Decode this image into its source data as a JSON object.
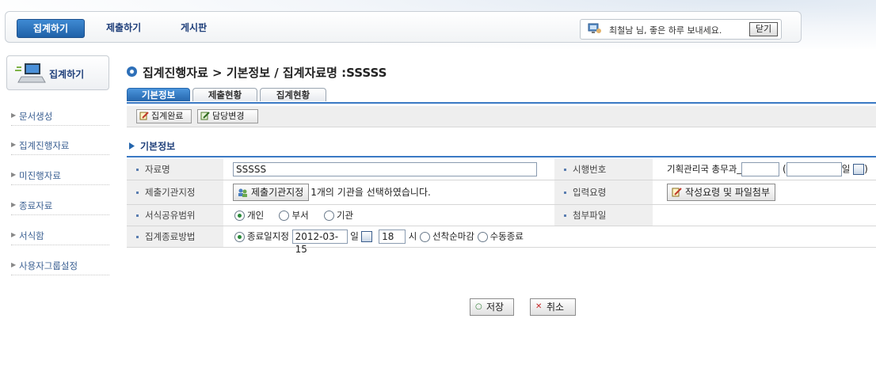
{
  "top_nav": {
    "tabs": [
      {
        "label": "집계하기",
        "active": true
      },
      {
        "label": "제출하기",
        "active": false
      },
      {
        "label": "게시판",
        "active": false
      }
    ],
    "greeting": "최철남 님, 좋은 하루 보내세요.",
    "close_label": "닫기"
  },
  "sidebar": {
    "header_label": "집계하기",
    "items": [
      {
        "label": "문서생성"
      },
      {
        "label": "집계진행자료"
      },
      {
        "label": "미진행자료"
      },
      {
        "label": "종료자료"
      },
      {
        "label": "서식함"
      },
      {
        "label": "사용자그룹설정"
      }
    ]
  },
  "main": {
    "title": "집계진행자료 > 기본정보 / 집계자료명 :SSSSS",
    "tabs": [
      {
        "label": "기본정보",
        "active": true
      },
      {
        "label": "제출현황",
        "active": false
      },
      {
        "label": "집계현황",
        "active": false
      }
    ],
    "toolbar": {
      "complete_label": "집계완료",
      "change_owner_label": "담당변경"
    },
    "section_title": "기본정보",
    "form": {
      "data_name_label": "자료명",
      "data_name_value": "SSSSS",
      "exec_no_label": "시행번호",
      "exec_no_prefix": "기획관리국 총무과_",
      "exec_no_open": "(",
      "exec_no_day": "일",
      "exec_no_close": ")",
      "org_label": "제출기관지정",
      "org_button": "제출기관지정",
      "org_status": "1개의 기관을 선택하였습니다.",
      "guide_label": "입력요령",
      "guide_button": "작성요령 및 파일첨부",
      "share_label": "서식공유범위",
      "share_options": [
        {
          "label": "개인",
          "selected": true
        },
        {
          "label": "부서",
          "selected": false
        },
        {
          "label": "기관",
          "selected": false
        }
      ],
      "attach_label": "첨부파일",
      "end_label": "집계종료방법",
      "end_opt_date": "종료일지정",
      "end_date": "2012-03-15",
      "end_day_unit": "일",
      "end_hour": "18",
      "end_hour_unit": "시",
      "end_opt_first": "선착순마감",
      "end_opt_manual": "수동종료"
    },
    "save_label": "저장",
    "cancel_label": "취소"
  },
  "colors": {
    "accent": "#2566ad",
    "brand_blue": "#1f3f7a"
  }
}
